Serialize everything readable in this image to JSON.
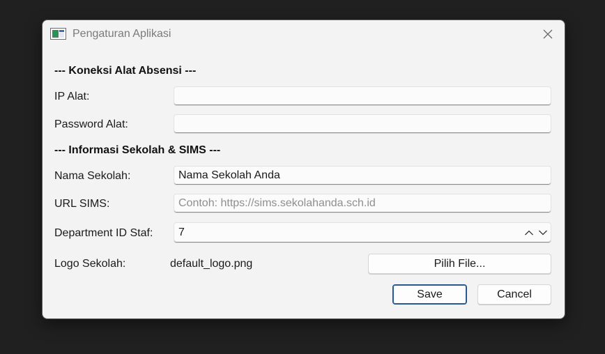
{
  "window": {
    "title": "Pengaturan Aplikasi"
  },
  "sections": {
    "device": "--- Koneksi Alat Absensi ---",
    "school": "--- Informasi Sekolah & SIMS ---"
  },
  "fields": {
    "ip": {
      "label": "IP Alat:",
      "value": ""
    },
    "password": {
      "label": "Password Alat:",
      "value": ""
    },
    "school_name": {
      "label": "Nama Sekolah:",
      "value": "Nama Sekolah Anda"
    },
    "sims_url": {
      "label": "URL SIMS:",
      "value": "",
      "placeholder": "Contoh: https://sims.sekolahanda.sch.id"
    },
    "dept_id": {
      "label": "Department ID Staf:",
      "value": "7"
    },
    "logo": {
      "label": "Logo Sekolah:",
      "value": "default_logo.png",
      "button": "Pilih File..."
    }
  },
  "buttons": {
    "save": "Save",
    "cancel": "Cancel"
  },
  "icons": {
    "app": "window-app-icon",
    "close": "close-icon",
    "up": "chevron-up-icon",
    "down": "chevron-down-icon"
  },
  "colors": {
    "background": "#202020",
    "dialog": "#f3f3f3",
    "accent": "#2e63a3"
  }
}
